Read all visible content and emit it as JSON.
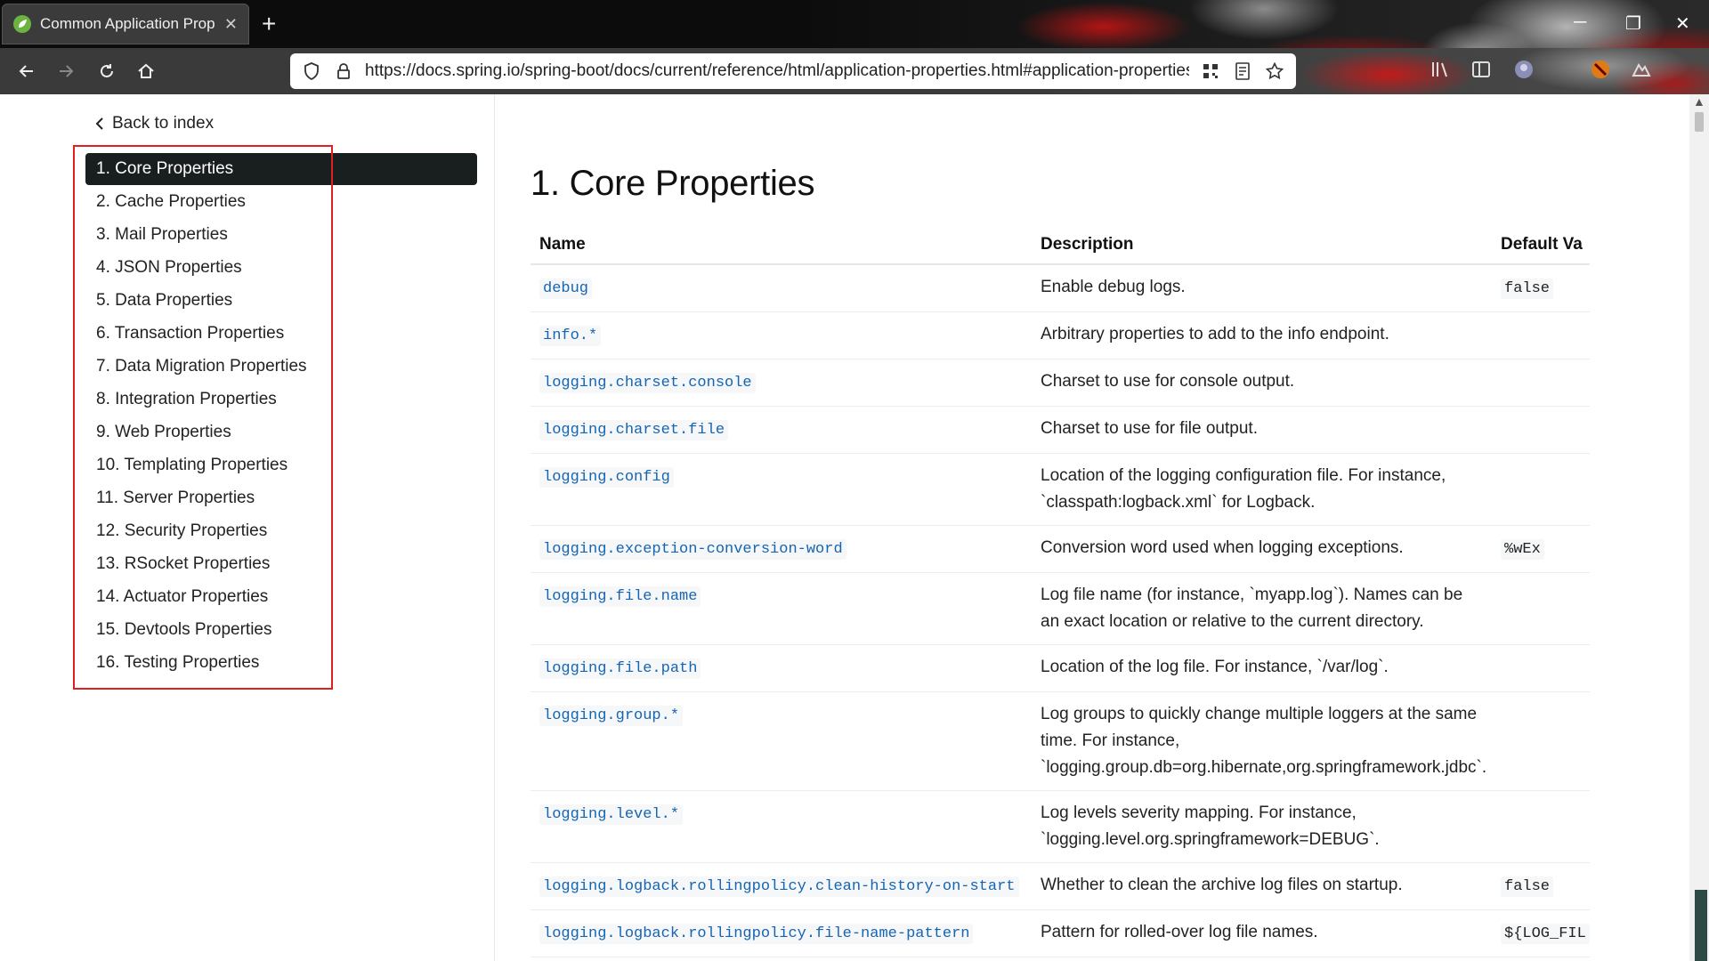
{
  "browser": {
    "tab_title": "Common Application Propert",
    "new_tab": "+",
    "url": "https://docs.spring.io/spring-boot/docs/current/reference/html/application-properties.html#application-properties",
    "controls": {
      "minimize": "─",
      "restore": "❐",
      "close": "✕"
    }
  },
  "sidebar": {
    "back_label": "Back to index",
    "items": [
      {
        "label": "1. Core Properties"
      },
      {
        "label": "2. Cache Properties"
      },
      {
        "label": "3. Mail Properties"
      },
      {
        "label": "4. JSON Properties"
      },
      {
        "label": "5. Data Properties"
      },
      {
        "label": "6. Transaction Properties"
      },
      {
        "label": "7. Data Migration Properties"
      },
      {
        "label": "8. Integration Properties"
      },
      {
        "label": "9. Web Properties"
      },
      {
        "label": "10. Templating Properties"
      },
      {
        "label": "11. Server Properties"
      },
      {
        "label": "12. Security Properties"
      },
      {
        "label": "13. RSocket Properties"
      },
      {
        "label": "14. Actuator Properties"
      },
      {
        "label": "15. Devtools Properties"
      },
      {
        "label": "16. Testing Properties"
      }
    ]
  },
  "main": {
    "heading": "1. Core Properties",
    "columns": {
      "name": "Name",
      "description": "Description",
      "default": "Default Va"
    },
    "rows": [
      {
        "name": "debug",
        "description": "Enable debug logs.",
        "default": "false"
      },
      {
        "name": "info.*",
        "description": "Arbitrary properties to add to the info endpoint.",
        "default": ""
      },
      {
        "name": "logging.charset.console",
        "description": "Charset to use for console output.",
        "default": ""
      },
      {
        "name": "logging.charset.file",
        "description": "Charset to use for file output.",
        "default": ""
      },
      {
        "name": "logging.config",
        "description": "Location of the logging configuration file. For instance, `classpath:logback.xml` for Logback.",
        "default": ""
      },
      {
        "name": "logging.exception-conversion-word",
        "description": "Conversion word used when logging exceptions.",
        "default": "%wEx"
      },
      {
        "name": "logging.file.name",
        "description": "Log file name (for instance, `myapp.log`). Names can be an exact location or relative to the current directory.",
        "default": ""
      },
      {
        "name": "logging.file.path",
        "description": "Location of the log file. For instance, `/var/log`.",
        "default": ""
      },
      {
        "name": "logging.group.*",
        "description": "Log groups to quickly change multiple loggers at the same time. For instance, `logging.group.db=org.hibernate,org.springframework.jdbc`.",
        "default": ""
      },
      {
        "name": "logging.level.*",
        "description": "Log levels severity mapping. For instance, `logging.level.org.springframework=DEBUG`.",
        "default": ""
      },
      {
        "name": "logging.logback.rollingpolicy.clean-history-on-start",
        "description": "Whether to clean the archive log files on startup.",
        "default": "false"
      },
      {
        "name": "logging.logback.rollingpolicy.file-name-pattern",
        "description": "Pattern for rolled-over log file names.",
        "default": "${LOG_FIL"
      }
    ]
  },
  "colors": {
    "active_nav_bg": "#191e1e",
    "property_link": "#1565b2",
    "highlight_border": "#e02020"
  }
}
